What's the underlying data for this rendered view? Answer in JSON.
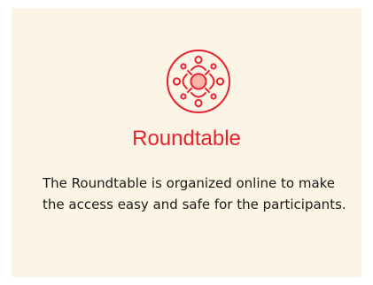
{
  "card": {
    "icon": "roundtable-people-icon",
    "title": "Roundtable",
    "description": "The Roundtable is organized online to make the access easy and safe for the participants.",
    "accent_color": "#e8232f",
    "background_color": "#fcf4e4"
  }
}
